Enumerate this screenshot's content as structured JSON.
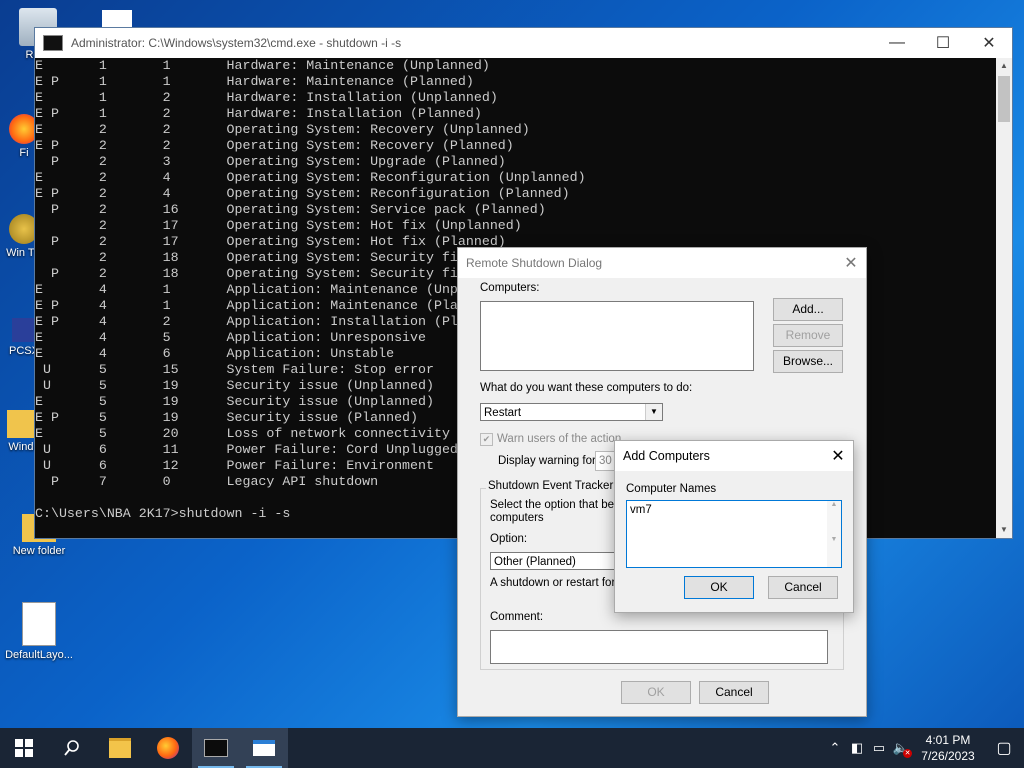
{
  "desktop": {
    "icons": [
      {
        "label": "Recy"
      },
      {
        "label": "Fi"
      },
      {
        "label": "Win Tw"
      },
      {
        "label": "PCSX"
      },
      {
        "label": "Windo"
      },
      {
        "label": "New folder"
      },
      {
        "label": "DefaultLayo..."
      }
    ]
  },
  "cmd": {
    "title": "Administrator: C:\\Windows\\system32\\cmd.exe - shutdown  -i -s",
    "minimize": "—",
    "maximize": "☐",
    "close": "✕",
    "lines": [
      "E       1       1       Hardware: Maintenance (Unplanned)",
      "E P     1       1       Hardware: Maintenance (Planned)",
      "E       1       2       Hardware: Installation (Unplanned)",
      "E P     1       2       Hardware: Installation (Planned)",
      "E       2       2       Operating System: Recovery (Unplanned)",
      "E P     2       2       Operating System: Recovery (Planned)",
      "  P     2       3       Operating System: Upgrade (Planned)",
      "E       2       4       Operating System: Reconfiguration (Unplanned)",
      "E P     2       4       Operating System: Reconfiguration (Planned)",
      "  P     2       16      Operating System: Service pack (Planned)",
      "        2       17      Operating System: Hot fix (Unplanned)",
      "  P     2       17      Operating System: Hot fix (Planned)",
      "        2       18      Operating System: Security fi",
      "  P     2       18      Operating System: Security fi",
      "E       4       1       Application: Maintenance (Unp",
      "E P     4       1       Application: Maintenance (Pla",
      "E P     4       2       Application: Installation (Pl",
      "E       4       5       Application: Unresponsive",
      "E       4       6       Application: Unstable",
      " U      5       15      System Failure: Stop error",
      " U      5       19      Security issue (Unplanned)",
      "E       5       19      Security issue (Unplanned)",
      "E P     5       19      Security issue (Planned)",
      "E       5       20      Loss of network connectivity",
      " U      6       11      Power Failure: Cord Unplugged",
      " U      6       12      Power Failure: Environment",
      "  P     7       0       Legacy API shutdown",
      "",
      "C:\\Users\\NBA 2K17>shutdown -i -s"
    ]
  },
  "remote_dialog": {
    "title": "Remote Shutdown Dialog",
    "close": "✕",
    "computers_label": "Computers:",
    "add_button": "Add...",
    "remove_button": "Remove",
    "browse_button": "Browse...",
    "action_label": "What do you want these computers to do:",
    "action_value": "Restart",
    "warn_label": "Warn users of the action",
    "display_warning_label": "Display warning for",
    "display_warning_value": "30",
    "tracker_label": "Shutdown Event Tracker",
    "tracker_desc_1": "Select the option that best",
    "tracker_desc_2": "computers",
    "option_label": "Option:",
    "option_value": "Other (Planned)",
    "option_desc": "A shutdown or restart for an",
    "comment_label": "Comment:",
    "ok_button": "OK",
    "cancel_button": "Cancel"
  },
  "add_dialog": {
    "title": "Add Computers",
    "close": "✕",
    "names_label": "Computer Names",
    "names_value": "vm7",
    "ok_button": "OK",
    "cancel_button": "Cancel"
  },
  "taskbar": {
    "time": "4:01 PM",
    "date": "7/26/2023",
    "notification_badge": "✕"
  },
  "colors": {
    "accent": "#0078d7",
    "taskbar": "#1a2535"
  }
}
